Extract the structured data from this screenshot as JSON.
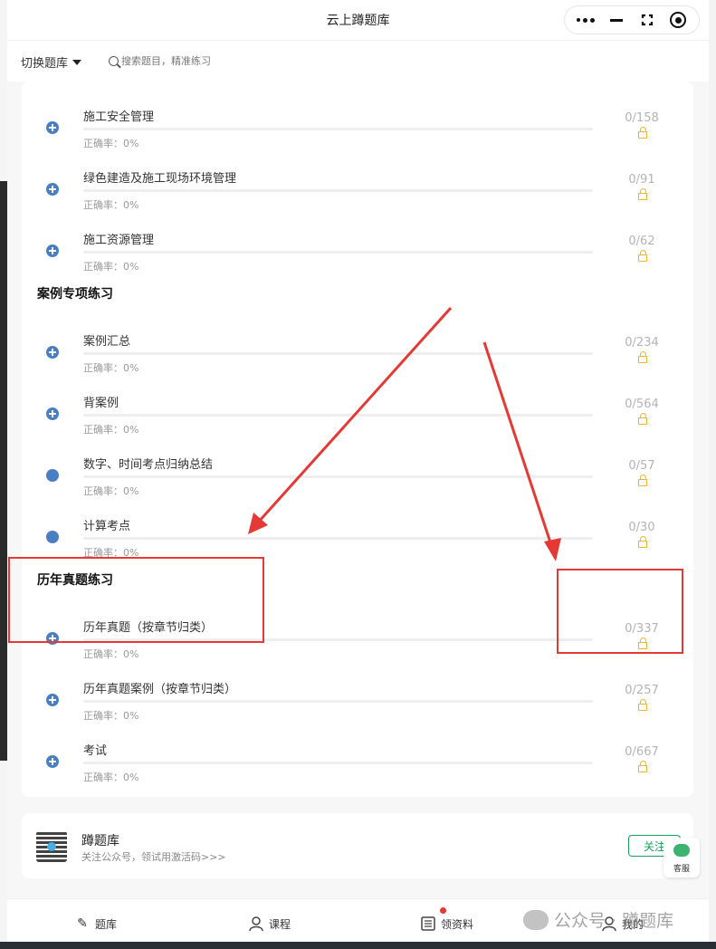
{
  "window": {
    "title": "云上蹲题库"
  },
  "toolbar": {
    "switch_label": "切换题库",
    "search_placeholder": "搜索题目，精准练习"
  },
  "rows_top": [
    {
      "name": "施工安全管理",
      "accuracy": "正确率：0%",
      "count": "0/158",
      "icon": "plus-circle-icon"
    },
    {
      "name": "绿色建造及施工现场环境管理",
      "accuracy": "正确率：0%",
      "count": "0/91",
      "icon": "plus-circle-icon"
    },
    {
      "name": "施工资源管理",
      "accuracy": "正确率：0%",
      "count": "0/62",
      "icon": "plus-circle-icon"
    }
  ],
  "section_case": {
    "title": "案例专项练习"
  },
  "rows_case": [
    {
      "name": "案例汇总",
      "accuracy": "正确率：0%",
      "count": "0/234",
      "icon": "plus-circle-icon"
    },
    {
      "name": "背案例",
      "accuracy": "正确率：0%",
      "count": "0/564",
      "icon": "plus-circle-icon"
    },
    {
      "name": "数字、时间考点归纳总结",
      "accuracy": "正确率：0%",
      "count": "0/57",
      "icon": "dot-icon"
    },
    {
      "name": "计算考点",
      "accuracy": "正确率：0%",
      "count": "0/30",
      "icon": "dot-icon"
    }
  ],
  "section_history": {
    "title": "历年真题练习"
  },
  "rows_history": [
    {
      "name": "历年真题（按章节归类）",
      "accuracy": "正确率：0%",
      "count": "0/337",
      "icon": "plus-circle-icon"
    },
    {
      "name": "历年真题案例（按章节归类）",
      "accuracy": "正确率：0%",
      "count": "0/257",
      "icon": "plus-circle-icon"
    },
    {
      "name": "考试",
      "accuracy": "正确率：0%",
      "count": "0/667",
      "icon": "plus-circle-icon"
    }
  ],
  "promo": {
    "title": "蹲题库",
    "subtitle": "关注公众号，领试用激活码>>>",
    "follow_label": "关注"
  },
  "service": {
    "label": "客服"
  },
  "tabbar": {
    "tab1": "题库",
    "tab2": "课程",
    "tab3": "领资料",
    "tab4": "我的"
  },
  "watermark": {
    "text": "公众号 · 蹲题库"
  },
  "colors": {
    "accent": "#4a7ec3",
    "lock": "#f0b429",
    "annotation": "#e53935",
    "follow": "#19a05a"
  }
}
